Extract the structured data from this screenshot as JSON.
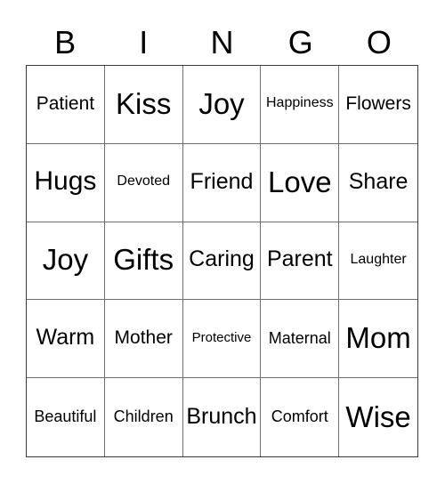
{
  "card": {
    "header": [
      "B",
      "I",
      "N",
      "G",
      "O"
    ],
    "rows": [
      [
        {
          "text": "Patient",
          "size": "m"
        },
        {
          "text": "Kiss",
          "size": "xl"
        },
        {
          "text": "Joy",
          "size": "xl"
        },
        {
          "text": "Happiness",
          "size": "s"
        },
        {
          "text": "Flowers",
          "size": "m"
        }
      ],
      [
        {
          "text": "Hugs",
          "size": "l"
        },
        {
          "text": "Devoted",
          "size": "s"
        },
        {
          "text": "Friend",
          "size": "ml"
        },
        {
          "text": "Love",
          "size": "xl"
        },
        {
          "text": "Share",
          "size": "ml"
        }
      ],
      [
        {
          "text": "Joy",
          "size": "xl"
        },
        {
          "text": "Gifts",
          "size": "xl"
        },
        {
          "text": "Caring",
          "size": "ml"
        },
        {
          "text": "Parent",
          "size": "ml"
        },
        {
          "text": "Laughter",
          "size": "s"
        }
      ],
      [
        {
          "text": "Warm",
          "size": "ml"
        },
        {
          "text": "Mother",
          "size": "m"
        },
        {
          "text": "Protective",
          "size": "xs"
        },
        {
          "text": "Maternal",
          "size": "sm"
        },
        {
          "text": "Mom",
          "size": "xl"
        }
      ],
      [
        {
          "text": "Beautiful",
          "size": "sm"
        },
        {
          "text": "Children",
          "size": "sm"
        },
        {
          "text": "Brunch",
          "size": "ml"
        },
        {
          "text": "Comfort",
          "size": "sm"
        },
        {
          "text": "Wise",
          "size": "xl"
        }
      ]
    ]
  }
}
